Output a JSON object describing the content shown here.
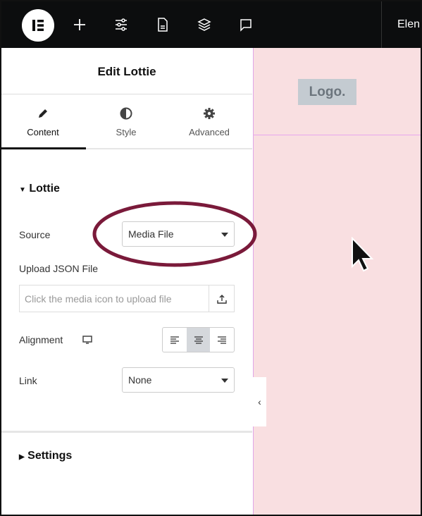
{
  "topbar": {
    "title_partial": "Elen",
    "icons": [
      "elementor-logo-icon",
      "plus-icon",
      "sliders-icon",
      "document-icon",
      "layers-icon",
      "comment-icon"
    ]
  },
  "panel": {
    "title": "Edit Lottie",
    "tabs": [
      {
        "label": "Content",
        "icon": "pencil-icon",
        "active": true
      },
      {
        "label": "Style",
        "icon": "contrast-icon"
      },
      {
        "label": "Advanced",
        "icon": "gear-icon"
      }
    ],
    "section": "Lottie",
    "source": {
      "label": "Source",
      "value": "Media File"
    },
    "upload": {
      "label": "Upload JSON File",
      "placeholder": "Click the media icon to upload file"
    },
    "alignment": {
      "label": "Alignment",
      "selected": "center",
      "options": [
        "left",
        "center",
        "right"
      ]
    },
    "link": {
      "label": "Link",
      "value": "None"
    },
    "settings_section": "Settings"
  },
  "canvas": {
    "logo_text": "Logo.",
    "background": "#f9dfe1"
  },
  "annotation": {
    "color": "#7a1a3a",
    "target": "source-select"
  }
}
